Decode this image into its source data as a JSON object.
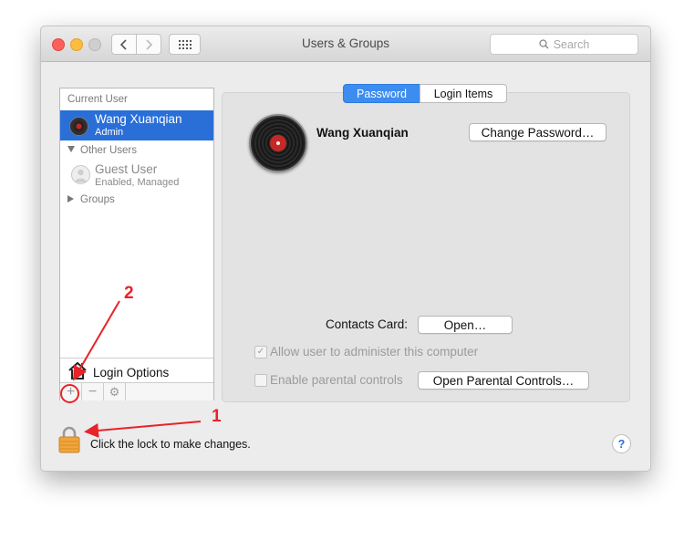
{
  "window": {
    "title": "Users & Groups",
    "search_placeholder": "Search"
  },
  "sidebar": {
    "current_user_heading": "Current User",
    "current_user": {
      "name": "Wang Xuanqian",
      "role": "Admin"
    },
    "other_users_heading": "Other Users",
    "guest_user": {
      "name": "Guest User",
      "status": "Enabled, Managed"
    },
    "groups_label": "Groups",
    "login_options_label": "Login Options",
    "tools": {
      "add": "+",
      "remove": "−",
      "settings": "⚙"
    }
  },
  "tabs": [
    {
      "label": "Password",
      "selected": true
    },
    {
      "label": "Login Items",
      "selected": false
    }
  ],
  "user_panel": {
    "full_name": "Wang Xuanqian",
    "change_password_label": "Change Password…",
    "contacts_card_label": "Contacts Card:",
    "open_label": "Open…",
    "allow_admin_label": "Allow user to administer this computer",
    "allow_admin_checked": true,
    "parental_controls_label": "Enable parental controls",
    "parental_controls_checked": false,
    "open_parental_label": "Open Parental Controls…"
  },
  "footer": {
    "lock_text": "Click the lock to make changes.",
    "help_label": "?"
  },
  "annotations": {
    "label_1": "1",
    "label_2": "2",
    "color": "#e8232a"
  },
  "colors": {
    "selection": "#2a6ed8",
    "tab_active": "#3d8cf0"
  }
}
